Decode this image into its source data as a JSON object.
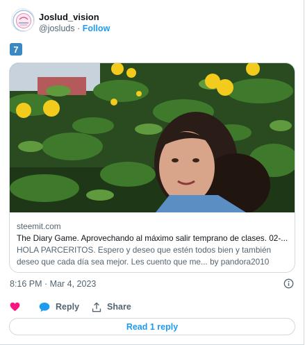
{
  "author": {
    "name": "Joslud_vision",
    "handle": "@josluds",
    "separator": " · ",
    "follow_label": "Follow"
  },
  "tweet": {
    "keycap": "7"
  },
  "card": {
    "domain": "steemit.com",
    "title": "The Diary Game. Aprovechando al máximo salir temprano de clases. 02-...",
    "description": "HOLA PARCERITOS. Espero y deseo que estén todos bien y también deseo que cada día sea mejor. Les cuento que me... by pandora2010"
  },
  "meta": {
    "timestamp": "8:16 PM · Mar 4, 2023"
  },
  "actions": {
    "reply_label": "Reply",
    "share_label": "Share"
  },
  "read_replies_label": "Read 1 reply",
  "colors": {
    "accent": "#1d9bf0",
    "like": "#f91880",
    "muted": "#536471",
    "border": "#cfd9de",
    "keycap": "#3b88c3"
  },
  "icons": [
    "heart-icon",
    "reply-bubble-icon",
    "share-icon",
    "info-icon"
  ]
}
